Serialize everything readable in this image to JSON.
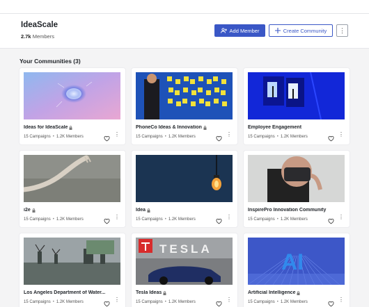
{
  "org": {
    "name": "IdeaScale",
    "member_count": "2.7k",
    "member_label": "Members"
  },
  "actions": {
    "add_member": "Add Member",
    "create_community": "Create Community",
    "more": "⋮"
  },
  "section": {
    "title": "Your Communities (3)"
  },
  "cards": [
    {
      "title": "Ideas for IdeaScale",
      "locked": true,
      "campaigns": "15 Campaigns",
      "members": "1.2K Members",
      "image": "brain"
    },
    {
      "title": "PhoneCo Ideas & Innovation",
      "locked": true,
      "campaigns": "15 Campaigns",
      "members": "1.2K Members",
      "image": "sticky-notes"
    },
    {
      "title": "Employee Engagement",
      "locked": false,
      "campaigns": "15 Campaigns",
      "members": "1.2K Members",
      "image": "blue-doors"
    },
    {
      "title": "i2e",
      "locked": true,
      "campaigns": "15 Campaigns",
      "members": "1.2K Members",
      "image": "robot-hand"
    },
    {
      "title": "Idea",
      "locked": true,
      "campaigns": "15 Campaigns",
      "members": "1.2K Members",
      "image": "light-bulb"
    },
    {
      "title": "InspirePro Innovation Community",
      "locked": false,
      "campaigns": "15 Campaigns",
      "members": "1.2K Members",
      "image": "vr-headset"
    },
    {
      "title": "Los Angeles Department of Water...",
      "locked": true,
      "campaigns": "15 Campaigns",
      "members": "1.2K Members",
      "image": "windmills"
    },
    {
      "title": "Tesla Ideas",
      "locked": true,
      "campaigns": "15 Campaigns",
      "members": "1.2K Members",
      "image": "tesla",
      "image_text": "TESLA"
    },
    {
      "title": "Artificial Intelligence",
      "locked": true,
      "campaigns": "15 Campaigns",
      "members": "1.2K Members",
      "image": "ai",
      "image_text": "AI"
    }
  ],
  "colors": {
    "primary": "#3a57c6",
    "background": "#f4f4f5"
  }
}
